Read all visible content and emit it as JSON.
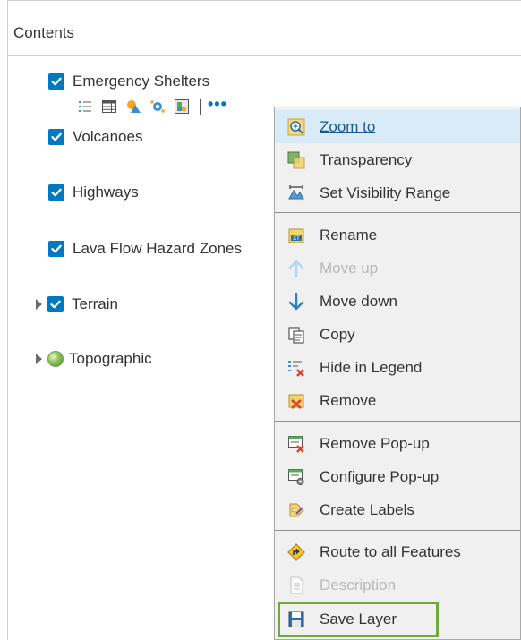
{
  "panel": {
    "title": "Contents"
  },
  "layers": [
    {
      "name": "Emergency Shelters",
      "checked": true,
      "expandable": false
    },
    {
      "name": "Volcanoes",
      "checked": true,
      "expandable": false
    },
    {
      "name": "Highways",
      "checked": true,
      "expandable": false
    },
    {
      "name": "Lava Flow Hazard Zones",
      "checked": true,
      "expandable": false
    },
    {
      "name": "Terrain",
      "checked": true,
      "expandable": true
    },
    {
      "name": "Topographic",
      "checked": false,
      "expandable": true,
      "icon": "globe-icon"
    }
  ],
  "layer_tools": [
    "show-legend-icon",
    "show-table-icon",
    "change-style-icon",
    "perform-analysis-icon",
    "filter-icon",
    "more-options-icon"
  ],
  "more_options_label": "•••",
  "menu": {
    "items": [
      {
        "label": "Zoom to",
        "icon": "zoom-to-icon",
        "active": true
      },
      {
        "label": "Transparency",
        "icon": "transparency-icon"
      },
      {
        "label": "Set Visibility Range",
        "icon": "visibility-range-icon"
      },
      {
        "label": "Rename",
        "icon": "rename-icon"
      },
      {
        "label": "Move up",
        "icon": "arrow-up-icon",
        "disabled": true
      },
      {
        "label": "Move down",
        "icon": "arrow-down-icon"
      },
      {
        "label": "Copy",
        "icon": "copy-icon"
      },
      {
        "label": "Hide in Legend",
        "icon": "hide-legend-icon"
      },
      {
        "label": "Remove",
        "icon": "remove-icon"
      },
      {
        "label": "Remove Pop-up",
        "icon": "remove-popup-icon"
      },
      {
        "label": "Configure Pop-up",
        "icon": "configure-popup-icon"
      },
      {
        "label": "Create Labels",
        "icon": "create-labels-icon"
      },
      {
        "label": "Route to all Features",
        "icon": "route-icon"
      },
      {
        "label": "Description",
        "icon": "description-icon",
        "disabled": true
      },
      {
        "label": "Save Layer",
        "icon": "save-icon",
        "highlighted": true
      }
    ]
  },
  "colors": {
    "accent": "#0079c1",
    "highlight_border": "#6eab3b",
    "menu_bg": "#f0f0f0",
    "menu_active": "#d9ebf7"
  }
}
